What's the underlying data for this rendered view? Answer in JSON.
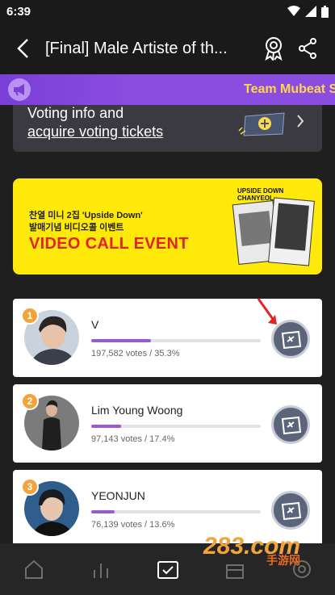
{
  "status_bar": {
    "time": "6:39"
  },
  "header": {
    "title": "[Final] Male Artiste of th..."
  },
  "banner": {
    "text": "Team Mubeat S"
  },
  "voting_info": {
    "line1": "Voting info and",
    "line2": "acquire voting tickets"
  },
  "promo": {
    "line1": "찬열 미니 2집 'Upside Down'",
    "line2": "발매기념 비디오콜 이벤트",
    "title": "VIDEO CALL EVENT",
    "album_title": "UPSIDE DOWN",
    "album_artist": "CHANYEOL"
  },
  "rankings": [
    {
      "rank": "1",
      "name": "V",
      "votes_text": "197,582 votes / 35.3%",
      "share": 35.3
    },
    {
      "rank": "2",
      "name": "Lim Young Woong",
      "votes_text": "97,143 votes / 17.4%",
      "share": 17.4
    },
    {
      "rank": "3",
      "name": "YEONJUN",
      "votes_text": "76,139 votes / 13.6%",
      "share": 13.6
    }
  ],
  "watermark": {
    "main": "283.com",
    "sub": "手游网"
  },
  "colors": {
    "accent_purple": "#9b59d0",
    "banner_purple": "#8b4ce0",
    "banner_text": "#ffd84a",
    "promo_yellow": "#ffe90a",
    "promo_red": "#e3232a",
    "rank_badge": "#f2a33a"
  },
  "icons": {
    "back": "arrow-left-icon",
    "badge": "award-icon",
    "share": "share-icon",
    "megaphone": "megaphone-icon",
    "vote": "ticket-vote-icon",
    "nav": [
      "home-icon",
      "chart-icon",
      "vote-check-icon",
      "store-icon",
      "profile-icon"
    ]
  }
}
